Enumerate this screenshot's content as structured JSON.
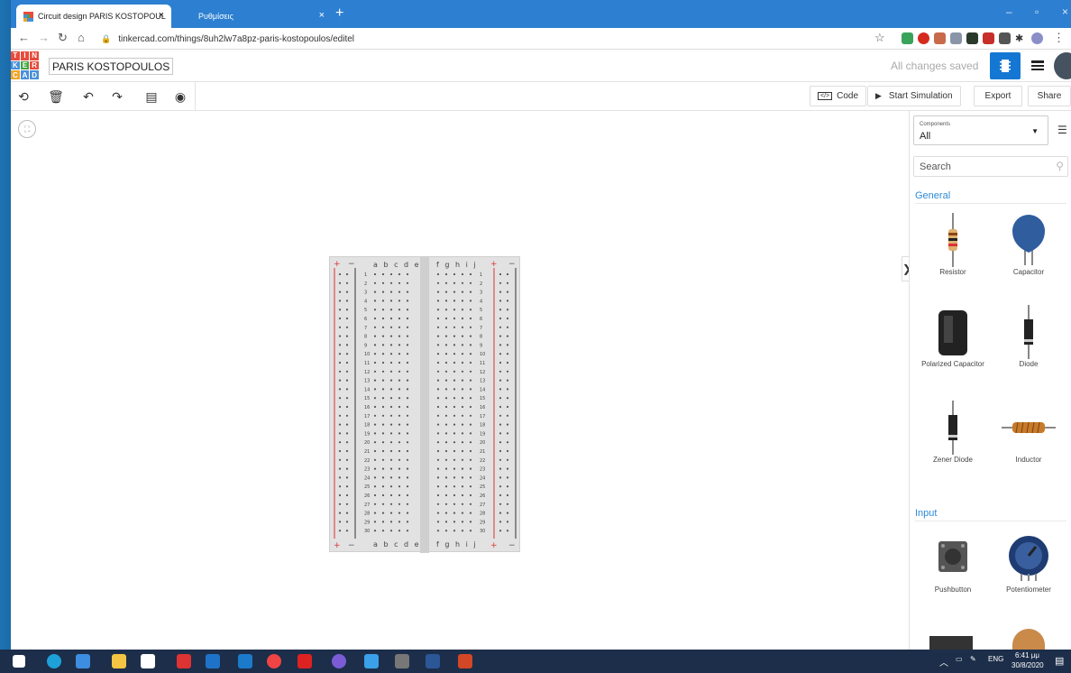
{
  "browser": {
    "tabs": [
      {
        "title": "Circuit design PARIS KOSTOPOUL",
        "close": "×"
      },
      {
        "title": "Ρυθμίσεις",
        "close": "×"
      }
    ],
    "new_tab": "+",
    "url": "tinkercad.com/things/8uh2lw7a8pz-paris-kostopoulos/editel",
    "window_controls": [
      "–",
      "▫",
      "×"
    ]
  },
  "app": {
    "logo_letters": [
      "T",
      "I",
      "N",
      "K",
      "E",
      "R",
      "C",
      "A",
      "D"
    ],
    "logo_colors": [
      "#e84b3c",
      "#e84b3c",
      "#e84b3c",
      "#4a8fd8",
      "#43a544",
      "#e84b3c",
      "#f0a52a",
      "#4a8fd8",
      "#4a8fd8"
    ],
    "project_name": "PARIS KOSTOPOULOS",
    "save_status": "All changes saved"
  },
  "toolbar": {
    "code_label": "Code",
    "code_icon": "</>",
    "start_sim_label": "Start Simulation",
    "export_label": "Export",
    "share_label": "Share"
  },
  "breadboard": {
    "left_cols": "a b c d e",
    "right_cols": "f g h i j",
    "plus": "+",
    "minus": "−",
    "rows": 30
  },
  "panel": {
    "components_label": "Components",
    "filter_value": "All",
    "search_placeholder": "Search",
    "sections": [
      {
        "title": "General",
        "items": [
          "Resistor",
          "Capacitor",
          "Polarized Capacitor",
          "Diode",
          "Zener Diode",
          "Inductor"
        ]
      },
      {
        "title": "Input",
        "items": [
          "Pushbutton",
          "Potentiometer"
        ]
      }
    ],
    "collapse_arrow": "❯"
  },
  "taskbar": {
    "lang": "ENG",
    "time": "6:41 μμ",
    "date": "30/8/2020"
  },
  "colors": {
    "accent": "#1477d4",
    "section": "#2b8ad8",
    "browser_tab": "#2d7fd1",
    "taskbar": "#1c2e4a"
  }
}
